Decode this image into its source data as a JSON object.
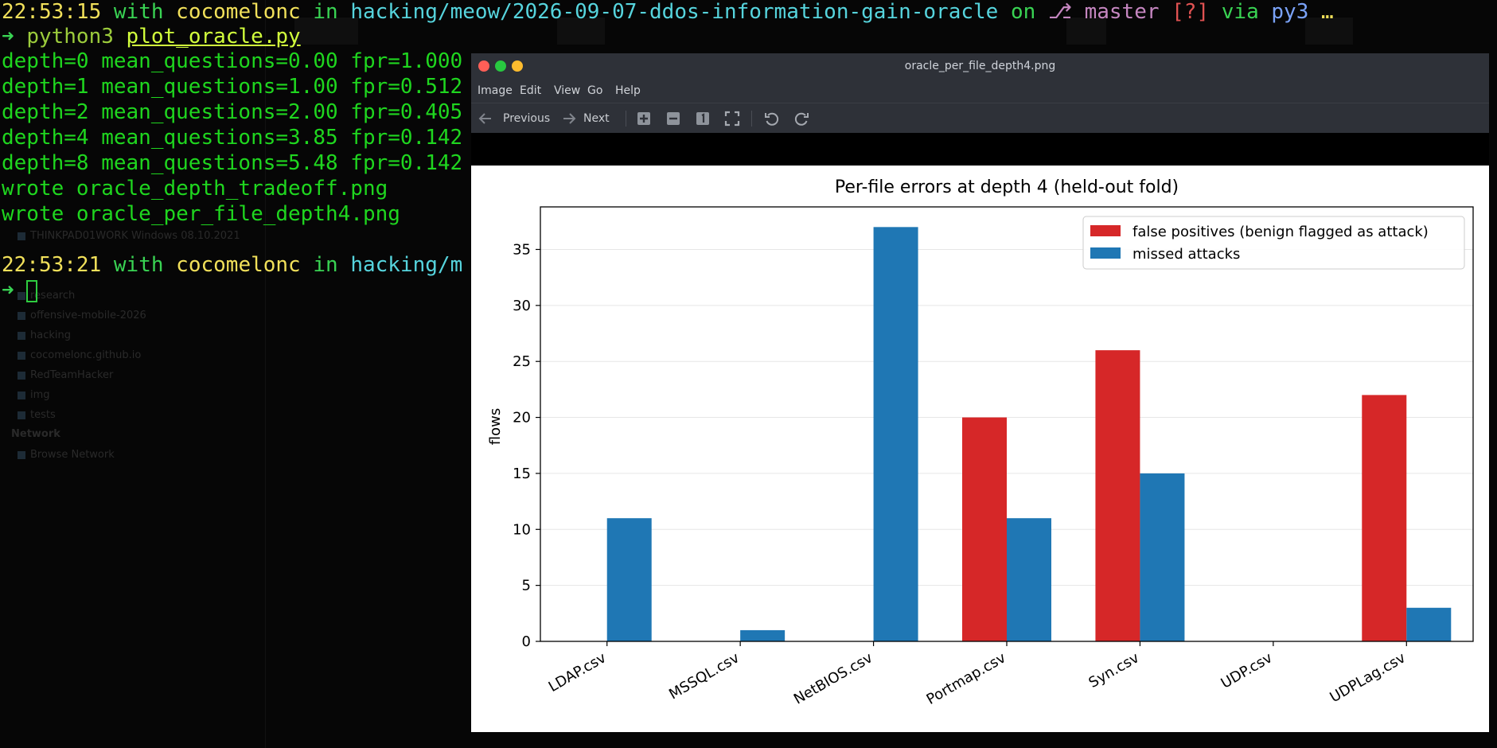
{
  "terminal": {
    "prompt1": {
      "time": "22:53:15",
      "with": "with",
      "user": "cocomelonc",
      "in": "in",
      "path": "hacking/meow/2026-09-07-ddos-information-gain-oracle",
      "on": "on",
      "branch_icon": "⎇",
      "branch": "master",
      "status": "[?]",
      "via": "via",
      "env": "py3",
      "more": "…"
    },
    "command": {
      "arrow": "➜",
      "program": "python3",
      "script": "plot_oracle.py"
    },
    "output": [
      "depth=0 mean_questions=0.00 fpr=1.000",
      "depth=1 mean_questions=1.00 fpr=0.512",
      "depth=2 mean_questions=2.00 fpr=0.405",
      "depth=4 mean_questions=3.85 fpr=0.142",
      "depth=8 mean_questions=5.48 fpr=0.142",
      "wrote oracle_depth_tradeoff.png",
      "wrote oracle_per_file_depth4.png"
    ],
    "prompt2": {
      "time": "22:53:21",
      "with": "with",
      "user": "cocomelonc",
      "in": "in",
      "path": "hacking/m"
    },
    "prompt_arrow": "➜"
  },
  "background_sidebar": {
    "items": [
      "THINKPAD01WORK Windows 08.10.2021",
      "research",
      "offensive-mobile-2026",
      "hacking",
      "cocomelonc.github.io",
      "RedTeamHacker",
      "img",
      "tests"
    ],
    "section": "Network",
    "network_item": "Browse Network"
  },
  "viewer": {
    "title": "oracle_per_file_depth4.png",
    "menu": [
      "Image",
      "Edit",
      "View",
      "Go",
      "Help"
    ],
    "toolbar": {
      "previous": "Previous",
      "next": "Next"
    },
    "icons": [
      "arrow-left-icon",
      "arrow-right-icon",
      "zoom-in-icon",
      "zoom-out-icon",
      "zoom-normal-icon",
      "fit-window-icon",
      "rotate-left-icon",
      "rotate-right-icon"
    ],
    "colors": {
      "close": "#ff5f57",
      "minimize": "#28c840",
      "maximize": "#febc2e"
    }
  },
  "chart_data": {
    "type": "bar",
    "title": "Per-file errors at depth 4 (held-out fold)",
    "xlabel": "",
    "ylabel": "flows",
    "categories": [
      "LDAP.csv",
      "MSSQL.csv",
      "NetBIOS.csv",
      "Portmap.csv",
      "Syn.csv",
      "UDP.csv",
      "UDPLag.csv"
    ],
    "series": [
      {
        "name": "false positives (benign flagged as attack)",
        "color": "#d62728",
        "values": [
          0,
          0,
          0,
          20,
          26,
          0,
          22
        ]
      },
      {
        "name": "missed attacks",
        "color": "#1f77b4",
        "values": [
          11,
          1,
          37,
          11,
          15,
          0,
          3
        ]
      }
    ],
    "ylim": [
      0,
      38.8
    ],
    "yticks": [
      0,
      5,
      10,
      15,
      20,
      25,
      30,
      35
    ],
    "grid": "horizontal",
    "legend": "top-right"
  }
}
